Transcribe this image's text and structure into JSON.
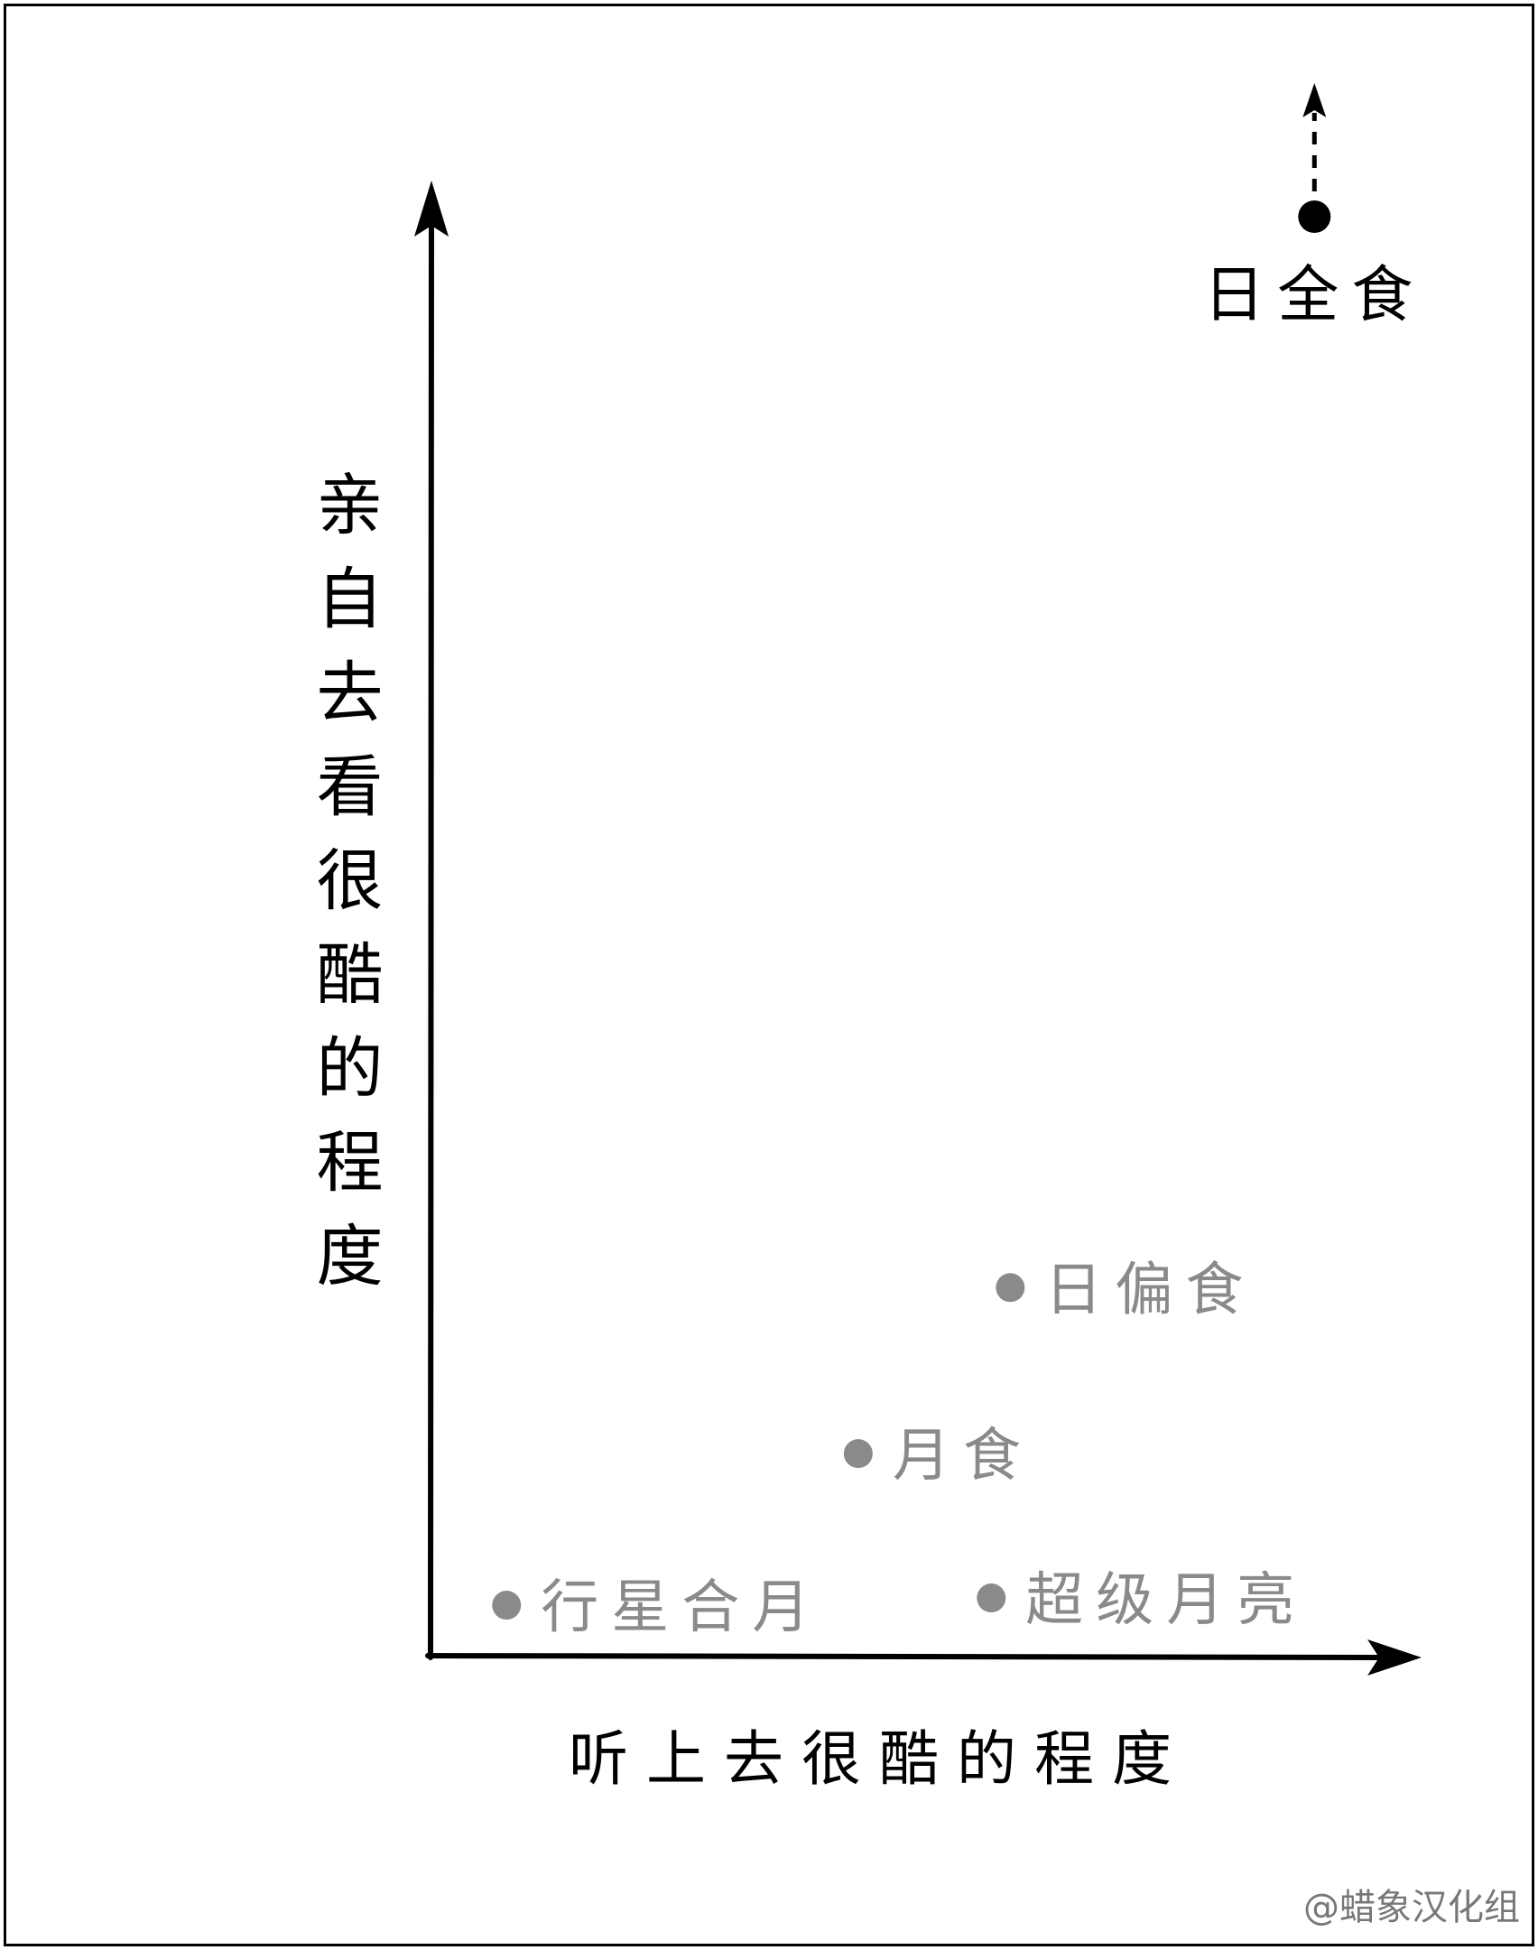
{
  "colors": {
    "highlight": "#000000",
    "muted": "#8a8a8a",
    "axis": "#000000",
    "credit": "#777777"
  },
  "chart_data": {
    "type": "scatter",
    "title": "",
    "xlabel": "听上去很酷的程度",
    "ylabel": "亲自去看很酷的程度",
    "xlim": [
      0,
      10
    ],
    "ylim": [
      0,
      10
    ],
    "grid": false,
    "legend": "none",
    "points": [
      {
        "label": "日全食",
        "x": 9.3,
        "y": 15.3,
        "highlight": true,
        "off_chart_arrow": "up"
      },
      {
        "label": "日偏食",
        "x": 6.1,
        "y": 2.55,
        "highlight": false
      },
      {
        "label": "月食",
        "x": 4.5,
        "y": 1.4,
        "highlight": false
      },
      {
        "label": "行星合月",
        "x": 0.8,
        "y": 0.35,
        "highlight": false
      },
      {
        "label": "超级月亮",
        "x": 5.9,
        "y": 0.4,
        "highlight": false
      }
    ]
  },
  "credit": "@蜡象汉化组"
}
